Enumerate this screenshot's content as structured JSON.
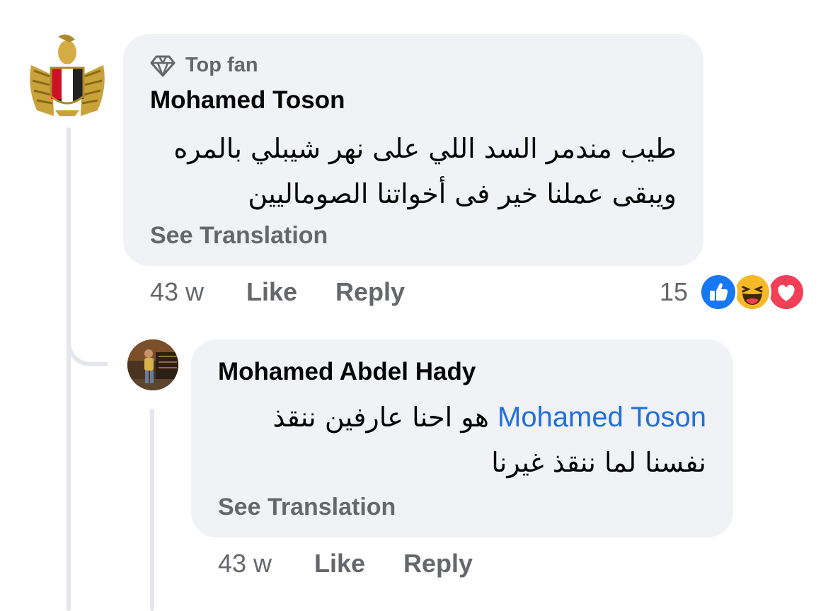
{
  "comment": {
    "badge_label": "Top fan",
    "author": "Mohamed Toson",
    "text_line1": "طيب مندمر السد اللي على نهر شيبلي بالمره",
    "text_line2": "ويبقى عملنا خير فى أخواتنا الصوماليين",
    "see_translation": "See Translation",
    "time": "43 w",
    "like_label": "Like",
    "reply_label": "Reply",
    "reaction_count": "15",
    "reactions": [
      "like-reaction-icon",
      "haha-reaction-icon",
      "love-reaction-icon"
    ],
    "colors": {
      "like": "#1877f2",
      "haha": "#f7b928",
      "love": "#f33e58"
    }
  },
  "reply": {
    "author": "Mohamed Abdel Hady",
    "mention": "Mohamed Toson",
    "text_line1": "هو احنا عارفين ننقذ",
    "text_line2": "نفسنا لما ننقذ غيرنا",
    "see_translation": "See Translation",
    "time": "43 w",
    "like_label": "Like",
    "reply_label": "Reply"
  },
  "colors": {
    "bubble": "#f0f2f5",
    "secondary_text": "#65676b",
    "mention": "#216fdb",
    "thread_line": "#e4e6eb"
  }
}
